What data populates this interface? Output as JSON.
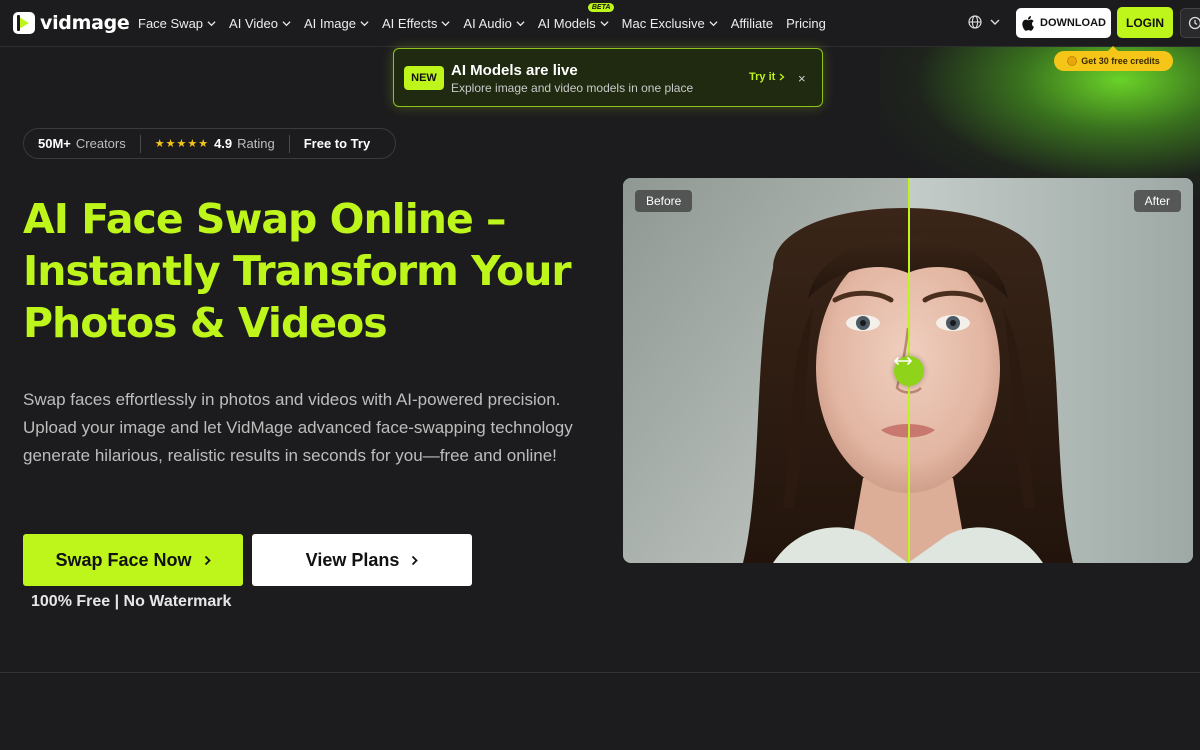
{
  "brand": {
    "logo_text": "vidmage"
  },
  "nav": {
    "items": [
      {
        "label": "Face Swap",
        "has_dropdown": true
      },
      {
        "label": "AI Video",
        "has_dropdown": true
      },
      {
        "label": "AI Image",
        "has_dropdown": true
      },
      {
        "label": "AI Effects",
        "has_dropdown": true
      },
      {
        "label": "AI Audio",
        "has_dropdown": true
      },
      {
        "label": "AI Models",
        "has_dropdown": true,
        "badge": "BETA"
      },
      {
        "label": "Mac Exclusive",
        "has_dropdown": true
      },
      {
        "label": "Affiliate",
        "has_dropdown": false
      },
      {
        "label": "Pricing",
        "has_dropdown": false
      }
    ],
    "download_label": "DOWNLOAD",
    "login_label": "LOGIN",
    "credits_label": "Get 30 free credits"
  },
  "banner": {
    "badge": "NEW",
    "title": "AI Models are live",
    "subtitle": "Explore image and video models in one place",
    "cta": "Try it",
    "close": "×"
  },
  "stats": {
    "creators_value": "50M+",
    "creators_label": "Creators",
    "stars": "★★★★★",
    "rating_value": "4.9",
    "rating_label": "Rating",
    "free_label": "Free to Try"
  },
  "hero": {
    "title_line1": "AI Face Swap Online –",
    "title_line2": "Instantly Transform Your",
    "title_line3": "Photos & Videos",
    "description": "Swap faces effortlessly in photos and videos with AI-powered precision. Upload your image and let VidMage advanced face-swapping technology generate hilarious, realistic results in seconds for you—free and online!",
    "primary_cta": "Swap Face Now",
    "secondary_cta": "View Plans",
    "note": "100% Free | No Watermark"
  },
  "compare": {
    "before_label": "Before",
    "after_label": "After",
    "split_position": 0.5
  },
  "colors": {
    "accent": "#bef51a",
    "background": "#1c1c1e",
    "credits": "#f5c518"
  }
}
